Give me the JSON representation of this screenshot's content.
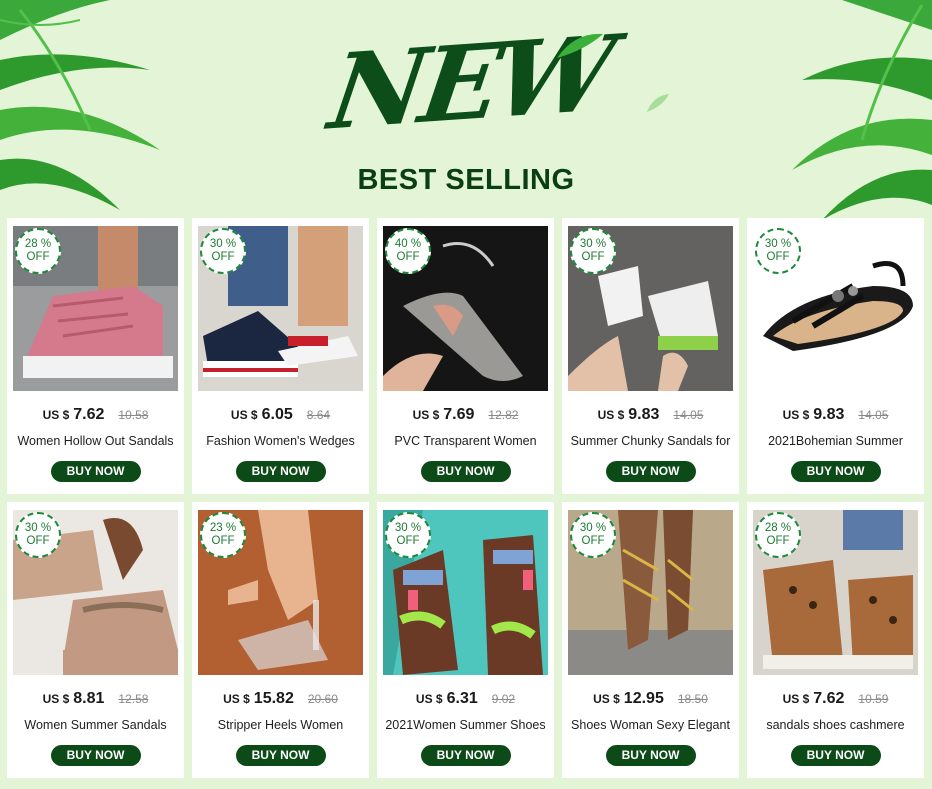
{
  "header": {
    "title": "NEW",
    "subtitle": "BEST SELLING"
  },
  "buy_label": "BUY NOW",
  "currency": "US $",
  "products": [
    {
      "discount_pct": "28 %",
      "discount_word": "OFF",
      "price": "7.62",
      "old_price": "10.58",
      "name": "Women Hollow Out Sandals",
      "image": "pink-woven-platform-sandal"
    },
    {
      "discount_pct": "30 %",
      "discount_word": "OFF",
      "price": "6.05",
      "old_price": "8.64",
      "name": "Fashion Women's Wedges",
      "image": "striped-wedge-flip-flop"
    },
    {
      "discount_pct": "40 %",
      "discount_word": "OFF",
      "price": "7.69",
      "old_price": "12.82",
      "name": "PVC Transparent Women",
      "image": "clear-pointed-flat"
    },
    {
      "discount_pct": "30 %",
      "discount_word": "OFF",
      "price": "9.83",
      "old_price": "14.05",
      "name": "Summer Chunky Sandals for",
      "image": "white-chunky-sport-sandal"
    },
    {
      "discount_pct": "30 %",
      "discount_word": "OFF",
      "price": "9.83",
      "old_price": "14.05",
      "name": "2021Bohemian Summer",
      "image": "black-bohemian-flat-sandal"
    },
    {
      "discount_pct": "30 %",
      "discount_word": "OFF",
      "price": "8.81",
      "old_price": "12.58",
      "name": "Women Summer Sandals",
      "image": "beige-chain-platform-sandal"
    },
    {
      "discount_pct": "23 %",
      "discount_word": "OFF",
      "price": "15.82",
      "old_price": "20.60",
      "name": "Stripper Heels Women",
      "image": "clear-high-heel-slide"
    },
    {
      "discount_pct": "30 %",
      "discount_word": "OFF",
      "price": "6.31",
      "old_price": "9.02",
      "name": "2021Women Summer Shoes",
      "image": "colorful-strap-sandal"
    },
    {
      "discount_pct": "30 %",
      "discount_word": "OFF",
      "price": "12.95",
      "old_price": "18.50",
      "name": "Shoes Woman Sexy Elegant",
      "image": "gold-lace-up-heel"
    },
    {
      "discount_pct": "28 %",
      "discount_word": "OFF",
      "price": "7.62",
      "old_price": "10.59",
      "name": "sandals shoes cashmere",
      "image": "leopard-wedge-sandal"
    }
  ],
  "colors": {
    "background": "#e3f5d6",
    "title": "#0d4d19",
    "button": "#0c4a17",
    "badge_border": "#1e8a3c"
  }
}
